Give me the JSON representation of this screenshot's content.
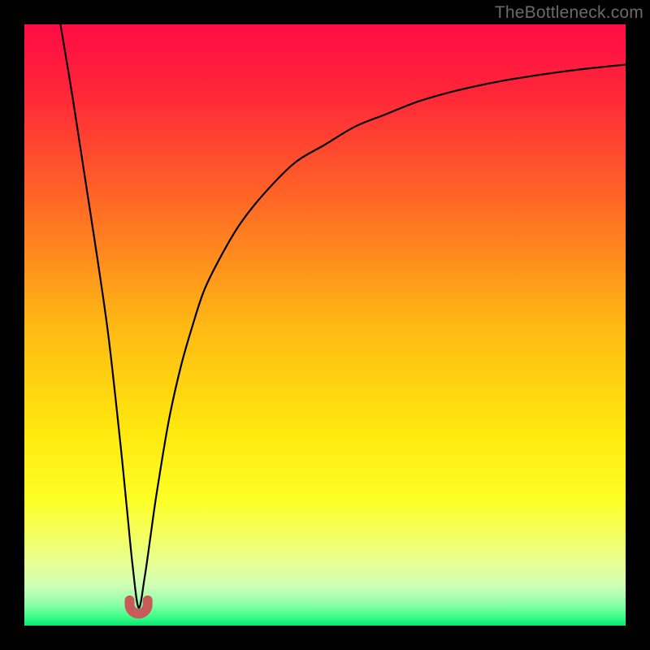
{
  "attribution": "TheBottleneck.com",
  "colors": {
    "frame": "#000000",
    "marker": "#c85a5a",
    "curve": "#000000",
    "gradient_stops": [
      {
        "offset": 0.0,
        "color": "#ff0b45"
      },
      {
        "offset": 0.12,
        "color": "#ff2838"
      },
      {
        "offset": 0.3,
        "color": "#ff6a25"
      },
      {
        "offset": 0.5,
        "color": "#ffb814"
      },
      {
        "offset": 0.68,
        "color": "#ffe90e"
      },
      {
        "offset": 0.79,
        "color": "#fdff25"
      },
      {
        "offset": 0.85,
        "color": "#f4ff60"
      },
      {
        "offset": 0.9,
        "color": "#e6ff97"
      },
      {
        "offset": 0.935,
        "color": "#ccffb8"
      },
      {
        "offset": 0.965,
        "color": "#8cffa8"
      },
      {
        "offset": 0.985,
        "color": "#3eff88"
      },
      {
        "offset": 1.0,
        "color": "#07e874"
      }
    ]
  },
  "chart_data": {
    "type": "line",
    "title": "",
    "xlabel": "",
    "ylabel": "",
    "xlim": [
      0,
      100
    ],
    "ylim": [
      0,
      100
    ],
    "grid": false,
    "legend": false,
    "note": "Values estimated from pixel positions; chart has no visible axis ticks or labels.",
    "optimum_x": 19,
    "series": [
      {
        "name": "bottleneck-curve",
        "x": [
          6,
          8,
          10,
          12,
          14,
          16,
          17,
          18,
          19,
          20,
          21,
          22,
          24,
          26,
          28,
          30,
          33,
          36,
          40,
          45,
          50,
          55,
          60,
          65,
          70,
          75,
          80,
          85,
          90,
          95,
          100
        ],
        "y": [
          100,
          88,
          75,
          62,
          48,
          30,
          20,
          10,
          3,
          8,
          15,
          22,
          34,
          43,
          50,
          56,
          62,
          67,
          72,
          77,
          80,
          83,
          85,
          87,
          88.5,
          89.7,
          90.7,
          91.5,
          92.2,
          92.8,
          93.3
        ]
      }
    ],
    "marker": {
      "name": "optimum-marker",
      "shape": "u",
      "x_range": [
        17.5,
        20.5
      ],
      "y": 2
    }
  }
}
